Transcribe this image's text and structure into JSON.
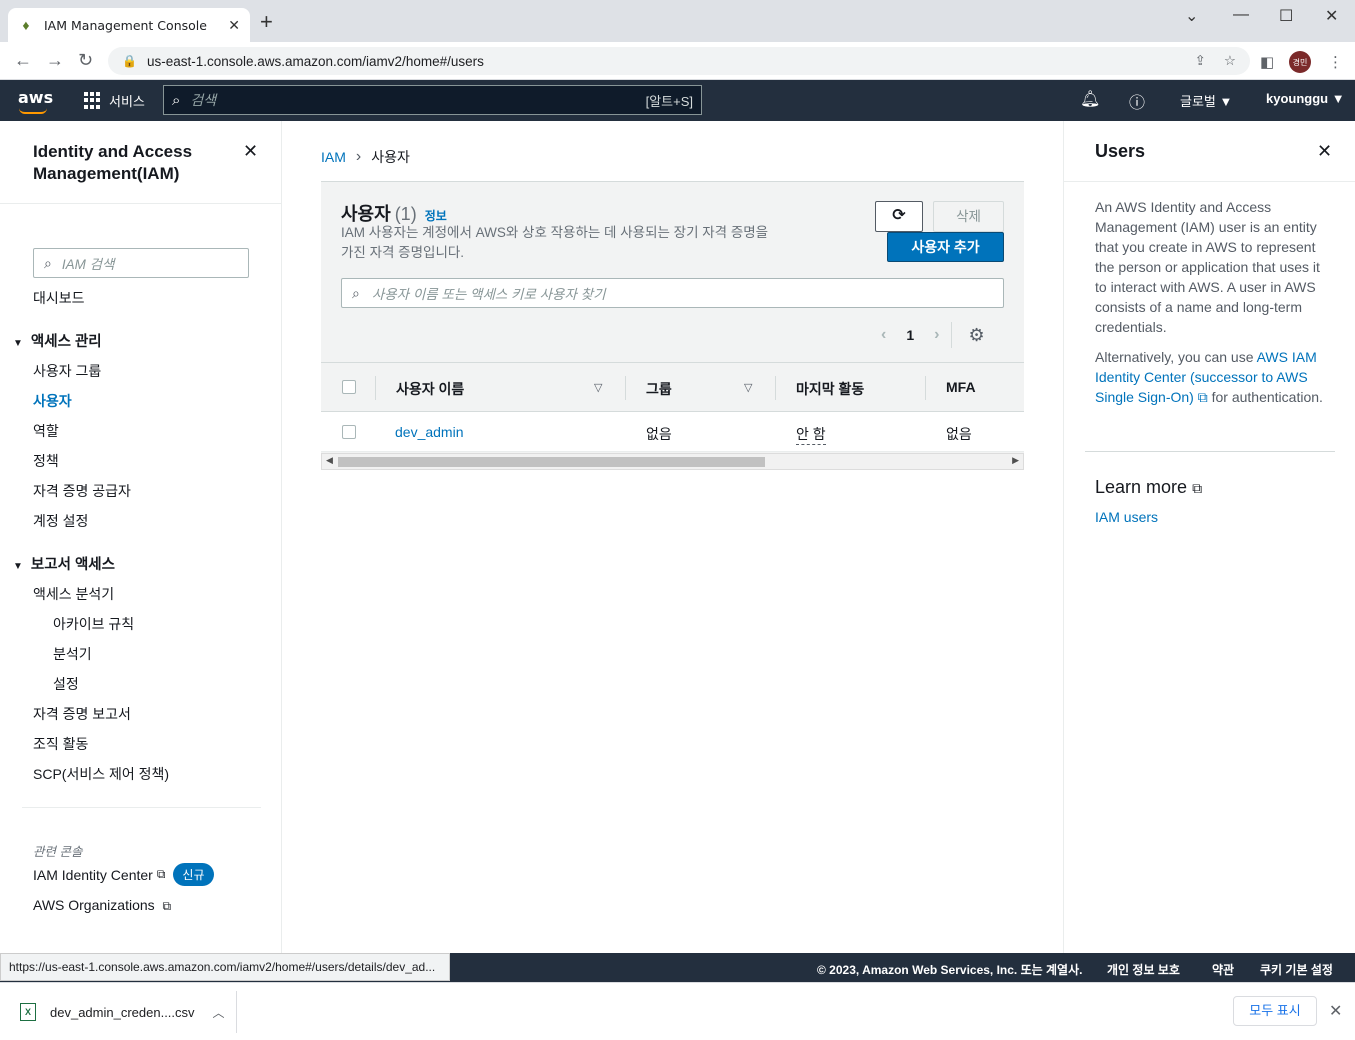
{
  "browser": {
    "tab_title": "IAM Management Console",
    "url": "us-east-1.console.aws.amazon.com/iamv2/home#/users",
    "profile_initials": "경민",
    "status_url": "https://us-east-1.console.aws.amazon.com/iamv2/home#/users/details/dev_ad..."
  },
  "topnav": {
    "logo": "aws",
    "services": "서비스",
    "search_placeholder": "검색",
    "search_shortcut": "[알트+S]",
    "region": "글로벌 ▼",
    "user": "kyounggu ▼"
  },
  "sidebar": {
    "title": "Identity and Access Management(IAM)",
    "search_placeholder": "IAM 검색",
    "dashboard": "대시보드",
    "section_access": "액세스 관리",
    "access_items": [
      "사용자 그룹",
      "사용자",
      "역할",
      "정책",
      "자격 증명 공급자",
      "계정 설정"
    ],
    "section_reports": "보고서 액세스",
    "report_items": [
      "액세스 분석기",
      "아카이브 규칙",
      "분석기",
      "설정",
      "자격 증명 보고서",
      "조직 활동",
      "SCP(서비스 제어 정책)"
    ],
    "related_caption": "관련 콘솔",
    "related": [
      "IAM Identity Center",
      "AWS Organizations"
    ],
    "new_badge": "신규"
  },
  "main": {
    "breadcrumb": [
      "IAM",
      "사용자"
    ],
    "title": "사용자",
    "count": "(1)",
    "info": "정보",
    "description": "IAM 사용자는 계정에서 AWS와 상호 작용하는 데 사용되는 장기 자격 증명을 가진 자격 증명입니다.",
    "delete_label": "삭제",
    "add_label": "사용자 추가",
    "search_placeholder": "사용자 이름 또는 액세스 키로 사용자 찾기",
    "page": "1",
    "columns": [
      "사용자 이름",
      "그룹",
      "마지막 활동",
      "MFA"
    ],
    "rows": [
      {
        "name": "dev_admin",
        "group": "없음",
        "last_activity": "안 함",
        "mfa": "없음"
      }
    ]
  },
  "help": {
    "title": "Users",
    "p1": "An AWS Identity and Access Management (IAM) user is an entity that you create in AWS to represent the person or application that uses it to interact with AWS. A user in AWS consists of a name and long-term credentials.",
    "p2_pre": "Alternatively, you can use ",
    "p2_link": "AWS IAM Identity Center (successor to AWS Single Sign-On)",
    "p2_post": " for authentication.",
    "learn_more": "Learn more",
    "learn_link": "IAM users"
  },
  "footer": {
    "copyright": "© 2023, Amazon Web Services, Inc. 또는 계열사.",
    "privacy": "개인 정보 보호",
    "terms": "약관",
    "cookies": "쿠키 기본 설정"
  },
  "download": {
    "file": "dev_admin_creden....csv",
    "show_all": "모두 표시"
  }
}
